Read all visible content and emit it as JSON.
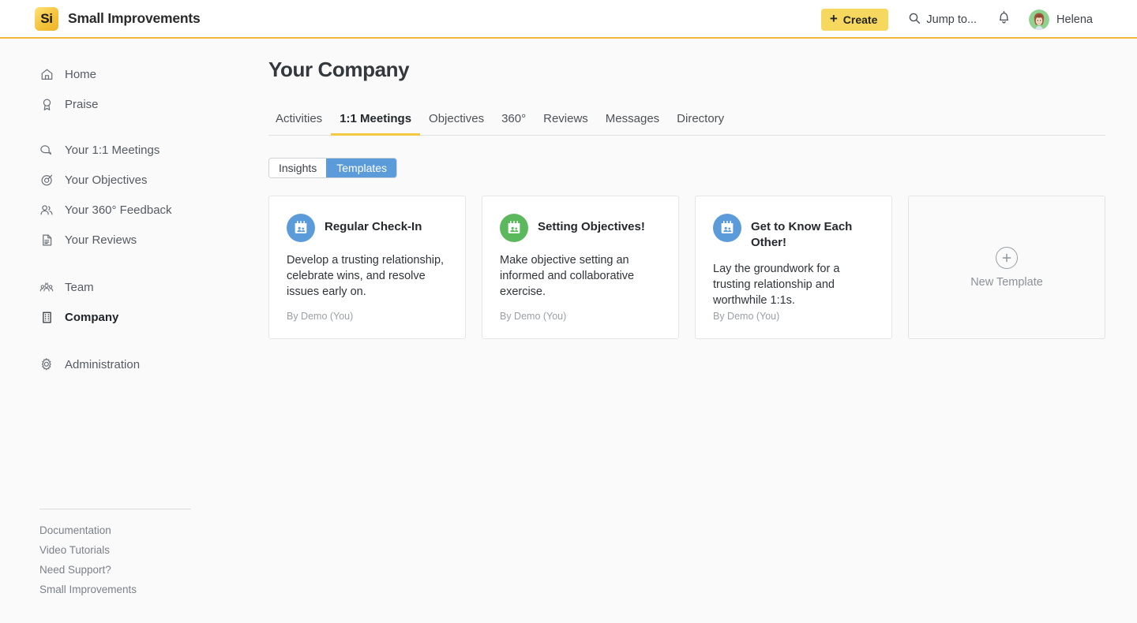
{
  "header": {
    "logo_text": "Si",
    "brand_name": "Small Improvements",
    "create_label": "Create",
    "create_plus": "+",
    "jump_to_label": "Jump to...",
    "user_name": "Helena",
    "accent_yellow": "#f0b93c",
    "create_button_color": "#f7d85e"
  },
  "sidebar": {
    "groups": [
      {
        "items": [
          {
            "label": "Home",
            "icon": "home-icon",
            "active": false
          },
          {
            "label": "Praise",
            "icon": "praise-badge-icon",
            "active": false
          }
        ]
      },
      {
        "items": [
          {
            "label": "Your 1:1 Meetings",
            "icon": "chat-bubble-icon",
            "active": false
          },
          {
            "label": "Your Objectives",
            "icon": "target-icon",
            "active": false
          },
          {
            "label": "Your 360° Feedback",
            "icon": "people-icon",
            "active": false
          },
          {
            "label": "Your Reviews",
            "icon": "document-icon",
            "active": false
          }
        ]
      },
      {
        "items": [
          {
            "label": "Team",
            "icon": "team-group-icon",
            "active": false
          },
          {
            "label": "Company",
            "icon": "building-icon",
            "active": true
          }
        ]
      },
      {
        "items": [
          {
            "label": "Administration",
            "icon": "gear-icon",
            "active": false
          }
        ]
      }
    ],
    "footer_links": [
      "Documentation",
      "Video Tutorials",
      "Need Support?",
      "Small Improvements"
    ]
  },
  "main": {
    "page_title": "Your Company",
    "tabs": [
      {
        "label": "Activities",
        "active": false
      },
      {
        "label": "1:1 Meetings",
        "active": true
      },
      {
        "label": "Objectives",
        "active": false
      },
      {
        "label": "360°",
        "active": false
      },
      {
        "label": "Reviews",
        "active": false
      },
      {
        "label": "Messages",
        "active": false
      },
      {
        "label": "Directory",
        "active": false
      }
    ],
    "segmented": [
      {
        "label": "Insights",
        "active": false
      },
      {
        "label": "Templates",
        "active": true
      }
    ],
    "segmented_active_color": "#5b9bd9",
    "cards": [
      {
        "title": "Regular Check-In",
        "description": "Develop a trusting relationship, celebrate wins, and resolve issues early on.",
        "author": "By Demo (You)",
        "icon": "calendar-people-icon",
        "icon_color": "#5b9bd9"
      },
      {
        "title": "Setting Objectives!",
        "description": "Make objective setting an informed and collaborative exercise.",
        "author": "By Demo (You)",
        "icon": "calendar-people-icon",
        "icon_color": "#5cb85c"
      },
      {
        "title": "Get to Know Each Other!",
        "description": "Lay the groundwork for a trusting relationship and worthwhile 1:1s.",
        "author": "By Demo (You)",
        "icon": "calendar-people-icon",
        "icon_color": "#5b9bd9"
      }
    ],
    "new_template": {
      "label": "New Template",
      "icon": "plus-circle-icon"
    }
  }
}
